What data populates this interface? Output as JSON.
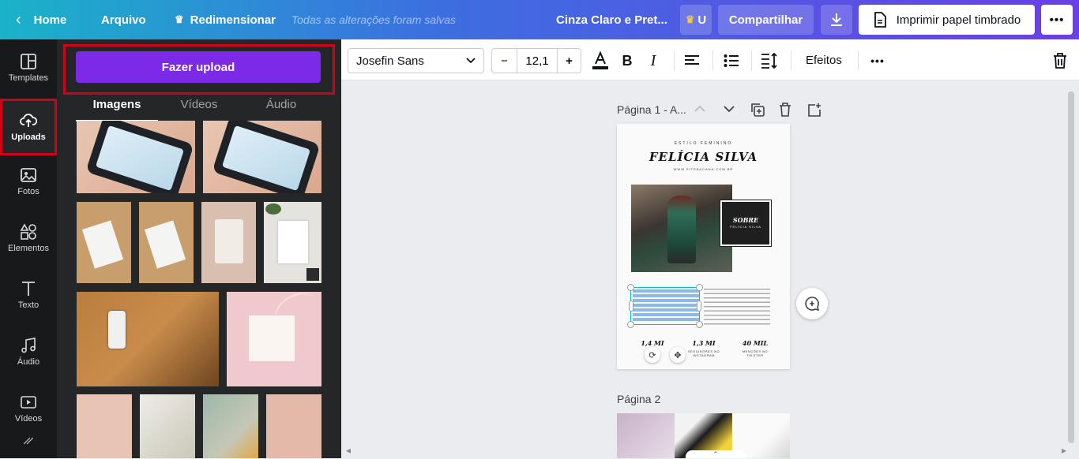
{
  "topbar": {
    "home": "Home",
    "file": "Arquivo",
    "resize": "Redimensionar",
    "saved_status": "Todas as alterações foram salvas",
    "doc_title": "Cinza Claro e Pret...",
    "upgrade": "U",
    "share": "Compartilhar",
    "print": "Imprimir papel timbrado",
    "more": "•••"
  },
  "rail": {
    "items": [
      {
        "label": "Templates",
        "icon": "templates-icon"
      },
      {
        "label": "Uploads",
        "icon": "upload-cloud-icon"
      },
      {
        "label": "Fotos",
        "icon": "photo-icon"
      },
      {
        "label": "Elementos",
        "icon": "elements-icon"
      },
      {
        "label": "Texto",
        "icon": "text-icon"
      },
      {
        "label": "Áudio",
        "icon": "music-icon"
      },
      {
        "label": "Vídeos",
        "icon": "video-icon"
      }
    ]
  },
  "panel": {
    "upload_button": "Fazer upload",
    "tabs": [
      "Imagens",
      "Vídeos",
      "Áudio"
    ]
  },
  "toolbar": {
    "font": "Josefin Sans",
    "size": "12,1",
    "minus": "−",
    "plus": "+",
    "effects": "Efeitos",
    "more": "•••"
  },
  "canvas": {
    "page1_label": "Página 1 - A...",
    "page2_label": "Página 2",
    "doc": {
      "kicker": "ESTILO FEMININO",
      "name": "FELÍCIA SILVA",
      "url": "WWW.SITEBACANA.COM.BR",
      "about_title": "SOBRE",
      "about_sub": "FELÍCIA SILVA",
      "stats": [
        {
          "value": "1,4 MI",
          "label": ""
        },
        {
          "value": "1,3 MI",
          "label": "SEGUIDORES NO INSTAGRAM"
        },
        {
          "value": "40 MIL",
          "label": "MENÇÕES NO TWITTER"
        }
      ]
    }
  }
}
